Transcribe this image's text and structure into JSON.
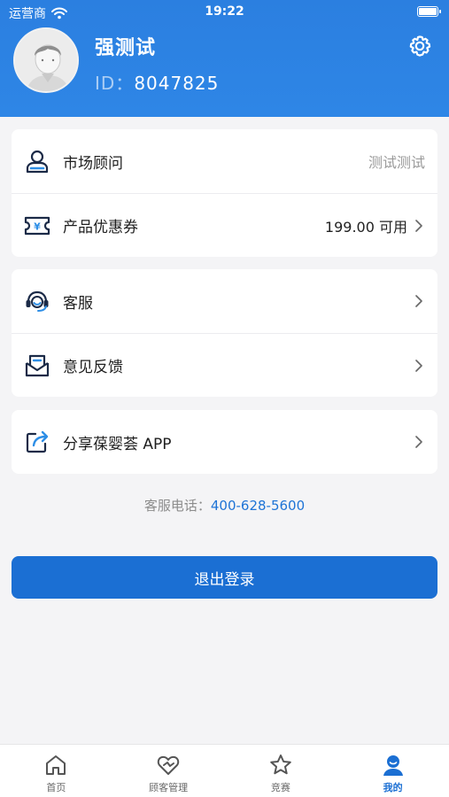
{
  "status_bar": {
    "carrier": "运营商",
    "time": "19:22"
  },
  "profile": {
    "name": "强测试",
    "id_label": "ID：",
    "id_value": "8047825"
  },
  "menu_group_1": {
    "advisor_label": "市场顾问",
    "advisor_value": "测试测试",
    "coupon_label": "产品优惠券",
    "coupon_value": "199.00 可用"
  },
  "menu_group_2": {
    "service_label": "客服",
    "feedback_label": "意见反馈"
  },
  "menu_group_3": {
    "share_label": "分享葆婴荟 APP"
  },
  "service_phone": {
    "label": "客服电话：",
    "number": "400-628-5600"
  },
  "logout_label": "退出登录",
  "tabbar": {
    "items": [
      {
        "label": "首页"
      },
      {
        "label": "顾客管理"
      },
      {
        "label": "竞赛"
      },
      {
        "label": "我的"
      }
    ]
  },
  "colors": {
    "primary": "#1b6fd3",
    "header": "#2b7fe0",
    "icon_dark": "#1b2a47",
    "icon_accent": "#2d8ee6"
  }
}
